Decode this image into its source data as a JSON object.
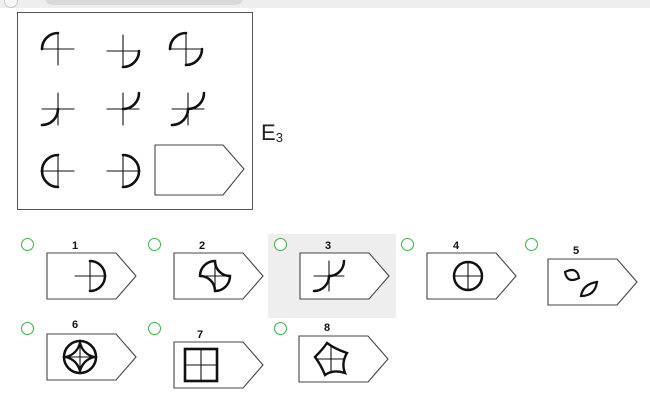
{
  "puzzle": {
    "code_letter": "E",
    "code_number": "3"
  },
  "options": [
    {
      "number": "1",
      "selected": false,
      "content": "plus with concave arc"
    },
    {
      "number": "2",
      "selected": false,
      "content": "plus inside curved pinwheel"
    },
    {
      "number": "3",
      "selected": true,
      "content": "plus with two concave arcs"
    },
    {
      "number": "4",
      "selected": false,
      "content": "circle with plus"
    },
    {
      "number": "5",
      "selected": false,
      "content": "two leaves"
    },
    {
      "number": "6",
      "selected": false,
      "content": "circle with inset astroid and plus"
    },
    {
      "number": "7",
      "selected": false,
      "content": "square with plus"
    },
    {
      "number": "8",
      "selected": false,
      "content": "plus inside concave quad"
    }
  ],
  "colors": {
    "radio_border": "#3cb043",
    "stroke": "#111111",
    "selected_bg": "#eeeeee"
  }
}
